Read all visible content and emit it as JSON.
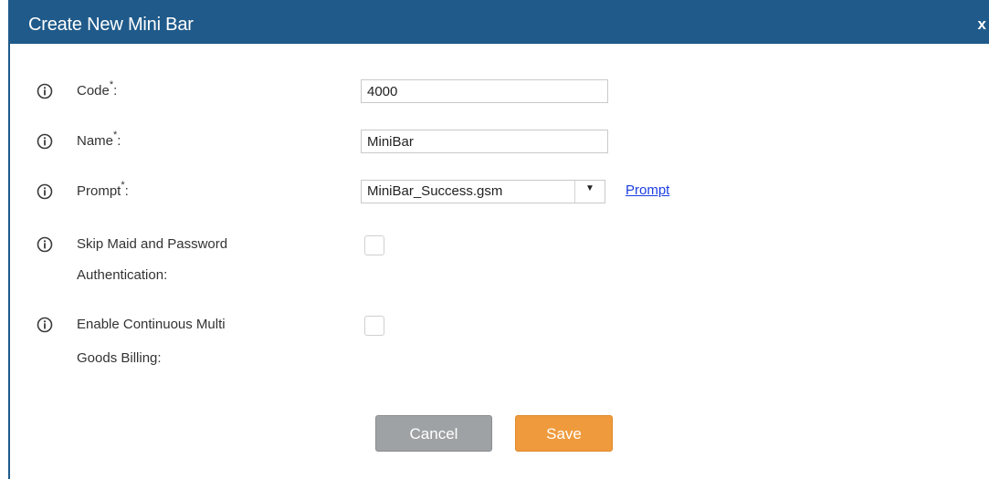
{
  "dialog": {
    "title": "Create New Mini Bar",
    "close_label": "x"
  },
  "form": {
    "code": {
      "label": "Code",
      "required_mark": "*",
      "suffix": ":",
      "value": "4000"
    },
    "name": {
      "label": "Name",
      "required_mark": "*",
      "suffix": ":",
      "value": "MiniBar"
    },
    "prompt": {
      "label": "Prompt",
      "required_mark": "*",
      "suffix": ":",
      "selected": "MiniBar_Success.gsm",
      "link_label": "Prompt"
    },
    "skip_maid": {
      "label_line1": "Skip Maid and Password",
      "label_line2": "Authentication:",
      "checked": false
    },
    "continuous_billing": {
      "label_line1": "Enable Continuous Multi",
      "label_line2": "Goods Billing:",
      "checked": false
    }
  },
  "buttons": {
    "cancel_label": "Cancel",
    "save_label": "Save"
  },
  "colors": {
    "titlebar": "#1f5a8a",
    "save": "#ef9a3c",
    "cancel": "#9fa2a4",
    "link": "#1a3ee0"
  },
  "icons": {
    "info": "info-icon",
    "close": "close-icon",
    "dropdown": "chevron-down-icon"
  }
}
